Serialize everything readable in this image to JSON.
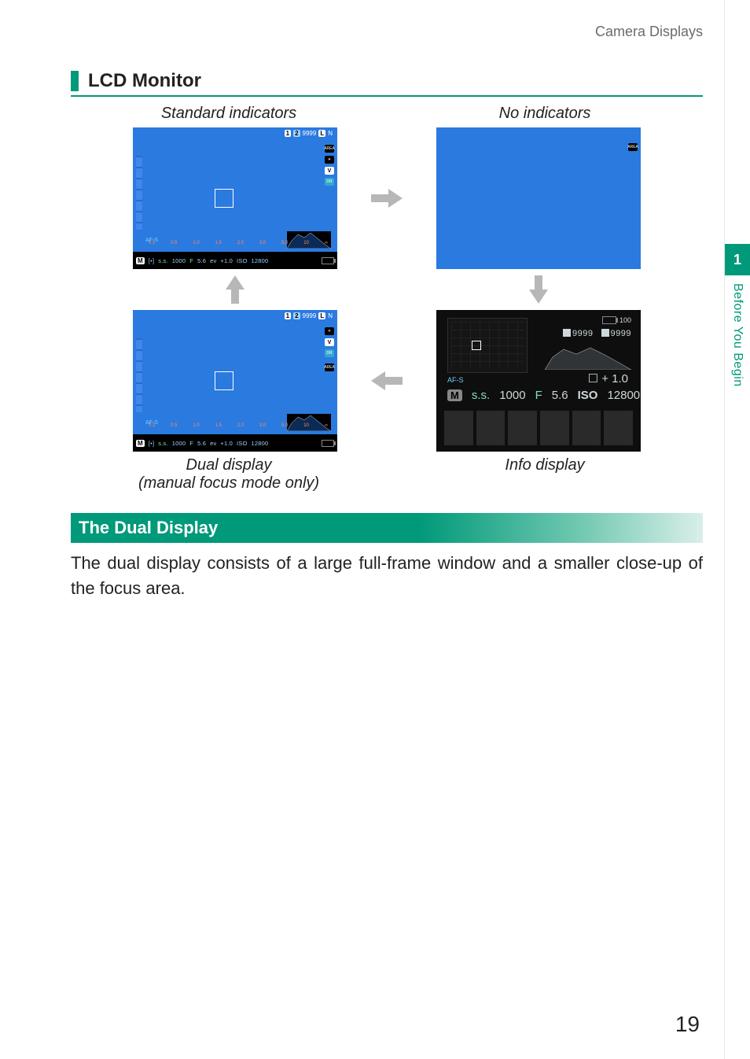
{
  "breadcrumb": "Camera Displays",
  "side_tab": {
    "chapter_number": "1",
    "chapter_title": "Before You Begin"
  },
  "section_title": "LCD Monitor",
  "captions": {
    "top_left": "Standard indicators",
    "top_right": "No indicators",
    "bottom_left_line1": "Dual display",
    "bottom_left_line2": "(manual focus mode only)",
    "bottom_right": "Info display"
  },
  "lcd_strip": {
    "mode": "M",
    "meter_icon": "[•]",
    "ss_icon": "s.s.",
    "shutter": "1000",
    "ap_icon": "F",
    "aperture": "5.6",
    "ev_icon": "ev",
    "ev": "+1.0",
    "iso_label": "ISO",
    "iso": "12800"
  },
  "lcd_top": {
    "card1": "1",
    "card2": "2",
    "frames": "9999",
    "size": "L",
    "quality": "N",
    "area_label": "AREA",
    "v_label": "V",
    "dr_label": "DR"
  },
  "distance_scale": {
    "af_mode": "AF-S",
    "marks": [
      "0.1",
      "0.5",
      "1.0",
      "1.5",
      "2.0",
      "3.0",
      "5.0",
      "10",
      "∞"
    ]
  },
  "info": {
    "battery_pct": "100",
    "shots1": "9999",
    "shots2": "9999",
    "ev_label": "+ 1.0",
    "af_mode": "AF-S",
    "mode": "M",
    "ss_label": "s.s.",
    "shutter": "1000",
    "ap_label": "F",
    "aperture": "5.6",
    "iso_label": "ISO",
    "iso": "12800"
  },
  "dual_heading": "The Dual Display",
  "dual_body": "The dual display consists of a large full-frame window and a smaller close-up of the focus area.",
  "page_number": "19"
}
